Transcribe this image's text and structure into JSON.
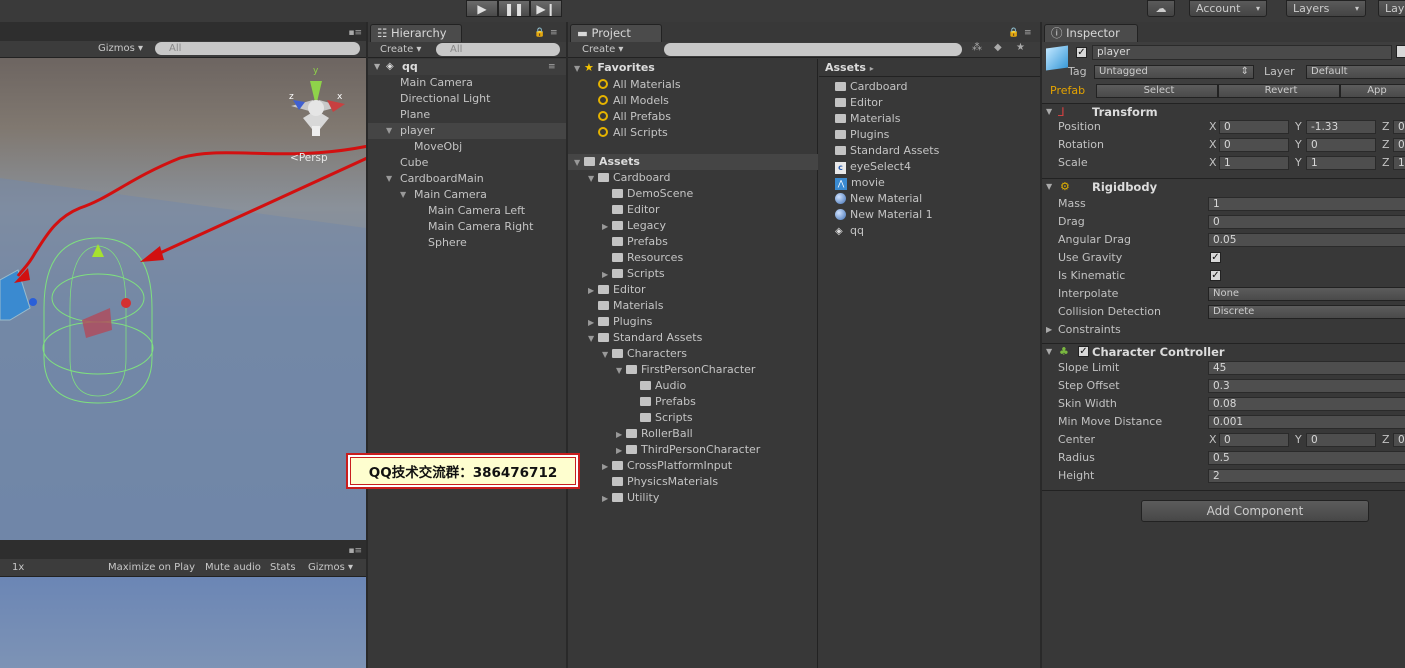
{
  "toolbar": {
    "play_icon": "play-icon",
    "pause_icon": "pause-icon",
    "step_icon": "step-icon",
    "account": "Account",
    "layers": "Layers",
    "layout": "Lay",
    "cloud_icon": "cloud-icon"
  },
  "scene": {
    "gizmos": "Gizmos",
    "search_placeholder": "All",
    "persp": "Persp",
    "axis_y": "y",
    "axis_x": "x",
    "axis_z": "z"
  },
  "game": {
    "scale": "1x",
    "maximize": "Maximize on Play",
    "mute": "Mute audio",
    "stats": "Stats",
    "gizmos": "Gizmos"
  },
  "hierarchy": {
    "tab": "Hierarchy",
    "create": "Create",
    "search_placeholder": "All",
    "scene_name": "qq",
    "items": [
      {
        "label": "Main Camera",
        "indent": 0
      },
      {
        "label": "Directional Light",
        "indent": 0
      },
      {
        "label": "Plane",
        "indent": 0
      },
      {
        "label": "player",
        "indent": 0
      },
      {
        "label": "MoveObj",
        "indent": 1
      },
      {
        "label": "Cube",
        "indent": 0
      },
      {
        "label": "CardboardMain",
        "indent": 0
      },
      {
        "label": "Main Camera",
        "indent": 1
      },
      {
        "label": "Main Camera Left",
        "indent": 2
      },
      {
        "label": "Main Camera Right",
        "indent": 2
      },
      {
        "label": "Sphere",
        "indent": 2
      }
    ]
  },
  "project": {
    "tab": "Project",
    "create": "Create",
    "favorites_title": "Favorites",
    "favorites": [
      "All Materials",
      "All Models",
      "All Prefabs",
      "All Scripts"
    ],
    "assets_title": "Assets",
    "tree": [
      {
        "label": "Cardboard",
        "indent": 1,
        "arrow": "open"
      },
      {
        "label": "DemoScene",
        "indent": 2,
        "arrow": ""
      },
      {
        "label": "Editor",
        "indent": 2,
        "arrow": ""
      },
      {
        "label": "Legacy",
        "indent": 2,
        "arrow": "closed"
      },
      {
        "label": "Prefabs",
        "indent": 2,
        "arrow": ""
      },
      {
        "label": "Resources",
        "indent": 2,
        "arrow": ""
      },
      {
        "label": "Scripts",
        "indent": 2,
        "arrow": "closed"
      },
      {
        "label": "Editor",
        "indent": 1,
        "arrow": "closed"
      },
      {
        "label": "Materials",
        "indent": 1,
        "arrow": ""
      },
      {
        "label": "Plugins",
        "indent": 1,
        "arrow": "closed"
      },
      {
        "label": "Standard Assets",
        "indent": 1,
        "arrow": "open"
      },
      {
        "label": "Characters",
        "indent": 2,
        "arrow": "open"
      },
      {
        "label": "FirstPersonCharacter",
        "indent": 3,
        "arrow": "open"
      },
      {
        "label": "Audio",
        "indent": 4,
        "arrow": ""
      },
      {
        "label": "Prefabs",
        "indent": 4,
        "arrow": ""
      },
      {
        "label": "Scripts",
        "indent": 4,
        "arrow": ""
      },
      {
        "label": "RollerBall",
        "indent": 3,
        "arrow": "closed"
      },
      {
        "label": "ThirdPersonCharacter",
        "indent": 3,
        "arrow": "closed"
      },
      {
        "label": "CrossPlatformInput",
        "indent": 2,
        "arrow": "closed"
      },
      {
        "label": "PhysicsMaterials",
        "indent": 2,
        "arrow": ""
      },
      {
        "label": "Utility",
        "indent": 2,
        "arrow": "closed"
      }
    ],
    "breadcrumb": "Assets",
    "assets_list": [
      {
        "label": "Cardboard",
        "icon": "folder"
      },
      {
        "label": "Editor",
        "icon": "folder"
      },
      {
        "label": "Materials",
        "icon": "folder"
      },
      {
        "label": "Plugins",
        "icon": "folder"
      },
      {
        "label": "Standard Assets",
        "icon": "folder"
      },
      {
        "label": "eyeSelect4",
        "icon": "script"
      },
      {
        "label": "movie",
        "icon": "movie"
      },
      {
        "label": "New Material",
        "icon": "material"
      },
      {
        "label": "New Material 1",
        "icon": "material"
      },
      {
        "label": "qq",
        "icon": "unity"
      }
    ]
  },
  "watermark": "QQ技术交流群：386476712",
  "inspector": {
    "tab": "Inspector",
    "object_name": "player",
    "tag_label": "Tag",
    "tag_value": "Untagged",
    "layer_label": "Layer",
    "layer_value": "Default",
    "prefab_label": "Prefab",
    "prefab_select": "Select",
    "prefab_revert": "Revert",
    "prefab_apply": "App",
    "transform": {
      "title": "Transform",
      "rows": [
        {
          "label": "Position",
          "x": "0",
          "y": "-1.33",
          "z": "0"
        },
        {
          "label": "Rotation",
          "x": "0",
          "y": "0",
          "z": "0"
        },
        {
          "label": "Scale",
          "x": "1",
          "y": "1",
          "z": "1"
        }
      ]
    },
    "rigidbody": {
      "title": "Rigidbody",
      "mass_label": "Mass",
      "mass": "1",
      "drag_label": "Drag",
      "drag": "0",
      "angular_label": "Angular Drag",
      "angular": "0.05",
      "gravity_label": "Use Gravity",
      "kinematic_label": "Is Kinematic",
      "interpolate_label": "Interpolate",
      "interpolate": "None",
      "collision_label": "Collision Detection",
      "collision": "Discrete",
      "constraints_label": "Constraints"
    },
    "character_controller": {
      "title": "Character Controller",
      "slope_label": "Slope Limit",
      "slope": "45",
      "step_label": "Step Offset",
      "step": "0.3",
      "skin_label": "Skin Width",
      "skin": "0.08",
      "minmove_label": "Min Move Distance",
      "minmove": "0.001",
      "center_label": "Center",
      "center_x": "0",
      "center_y": "0",
      "center_z": "0",
      "radius_label": "Radius",
      "radius": "0.5",
      "height_label": "Height",
      "height": "2"
    },
    "add_component": "Add Component",
    "axis_x": "X",
    "axis_y": "Y",
    "axis_z": "Z"
  }
}
